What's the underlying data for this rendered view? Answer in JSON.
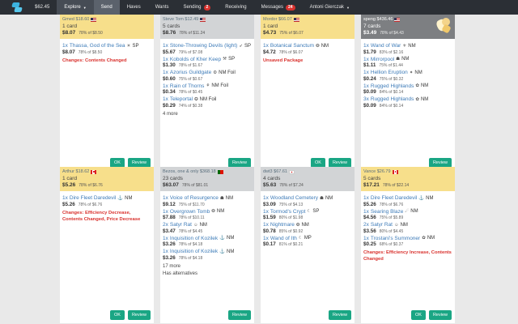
{
  "nav": {
    "balance": "$62.45",
    "explore": "Explore",
    "send": "Send",
    "haves": "Haves",
    "wants": "Wants",
    "sending": "Sending",
    "sending_count": "2",
    "receiving": "Receiving",
    "messages": "Messages",
    "messages_count": "24",
    "user": "Antoni Gierczak"
  },
  "buttons": {
    "ok": "OK",
    "review": "Review"
  },
  "cards": [
    {
      "name": "Gmed $18.60",
      "flag": "us",
      "count": "1 card",
      "total": "$8.07",
      "total_pct": "78% of $8.50",
      "items": [
        {
          "qty": "1x",
          "name": "Thassa, God of the Sea",
          "icon": "☀",
          "cond": "SP",
          "price": "$8.07",
          "pct": "78% of $8.50"
        }
      ],
      "warn": "Changes: Contents Changed",
      "ok": true
    },
    {
      "name": "Steve Tom $12.49",
      "flag": "us",
      "count": "5 cards",
      "total": "$8.76",
      "total_pct": "78% of $11.24",
      "items": [
        {
          "qty": "1x",
          "name": "Stone-Throwing Devils (light)",
          "icon": "➶",
          "cond": "SP",
          "price": "$5.67",
          "pct": "79% of $7.08"
        },
        {
          "qty": "1x",
          "name": "Kobolds of Kher Keep",
          "icon": "⚒",
          "cond": "SP",
          "price": "$1.30",
          "pct": "78% of $1.67"
        },
        {
          "qty": "1x",
          "name": "Azorius Guildgate",
          "icon": "⚙",
          "cond": "NM Foil",
          "price": "$0.60",
          "pct": "75% of $0.67"
        },
        {
          "qty": "1x",
          "name": "Rain of Thorns",
          "icon": "⚘",
          "cond": "NM Foil",
          "price": "$0.34",
          "pct": "78% of $0.45"
        },
        {
          "qty": "1x",
          "name": "Teleportal",
          "icon": "✪",
          "cond": "NM Foil",
          "price": "$0.29",
          "pct": "74% of $0.38"
        }
      ],
      "more": "4 more",
      "warn": "",
      "ok": false
    },
    {
      "name": "Mordor $66.07",
      "flag": "us",
      "count": "1 card",
      "total": "$4.73",
      "total_pct": "75% of $6.07",
      "items": [
        {
          "qty": "1x",
          "name": "Botanical Sanctum",
          "icon": "❂",
          "cond": "NM",
          "price": "$4.72",
          "pct": "78% of $6.07"
        }
      ],
      "warn": "Unsaved Package",
      "ok": true
    },
    {
      "name": "speng $436.46",
      "flag": "us",
      "count": "7 cards",
      "total": "$3.49",
      "total_pct": "78% of $4.43",
      "dark": true,
      "items": [
        {
          "qty": "1x",
          "name": "Wand of War",
          "icon": "⚜",
          "cond": "NM",
          "price": "$1.79",
          "pct": "83% of $2.16"
        },
        {
          "qty": "1x",
          "name": "Mirrorpool",
          "icon": "☗",
          "cond": "NM",
          "price": "$1.11",
          "pct": "75% of $1.44"
        },
        {
          "qty": "1x",
          "name": "Hellion Eruption",
          "icon": "✦",
          "cond": "NM",
          "price": "$0.24",
          "pct": "75% of $0.32"
        },
        {
          "qty": "1x",
          "name": "Rugged Highlands",
          "icon": "✿",
          "cond": "NM",
          "price": "$0.09",
          "pct": "84% of $0.14"
        },
        {
          "qty": "3x",
          "name": "Rugged Highlands",
          "icon": "✿",
          "cond": "NM",
          "price": "$0.09",
          "pct": "84% of $0.14"
        }
      ],
      "warn": "",
      "ok": false
    },
    {
      "name": "Arthur $18.62",
      "flag": "ca",
      "count": "1 card",
      "total": "$5.26",
      "total_pct": "78% of $6.76",
      "items": [
        {
          "qty": "1x",
          "name": "Dire Fleet Daredevil",
          "icon": "⚓",
          "cond": "NM",
          "price": "$5.26",
          "pct": "78% of $6.76"
        }
      ],
      "warn": "Changes: Efficiency Decrease, Contents Changed, Price Decrease",
      "ok": true
    },
    {
      "name": "Bezos, one & only $368.18",
      "flag": "pt",
      "count": "23 cards",
      "total": "$63.07",
      "total_pct": "78% of $81.01",
      "items": [
        {
          "qty": "1x",
          "name": "Voice of Resurgence",
          "icon": "☗",
          "cond": "NM",
          "price": "$9.12",
          "pct": "75% of $11.70"
        },
        {
          "qty": "1x",
          "name": "Overgrown Tomb",
          "icon": "❂",
          "cond": "NM",
          "price": "$7.88",
          "pct": "78% of $10.11"
        },
        {
          "qty": "2x",
          "name": "Satyr Rat",
          "icon": "☺",
          "cond": "NM",
          "price": "$3.47",
          "pct": "78% of $4.45"
        },
        {
          "qty": "1x",
          "name": "Inquisition of Kozilek",
          "icon": "⚓",
          "cond": "NM",
          "price": "$3.26",
          "pct": "78% of $4.18"
        },
        {
          "qty": "1x",
          "name": "Inquisition of Kozilek",
          "icon": "⚓",
          "cond": "NM",
          "price": "$3.26",
          "pct": "78% of $4.18"
        }
      ],
      "more": "17 more",
      "extra": "Has alternatives",
      "warn": "",
      "ok": false
    },
    {
      "name": "dwt3 $67.61",
      "flag": "jp",
      "count": "4 cards",
      "total": "$5.63",
      "total_pct": "78% of $7.24",
      "items": [
        {
          "qty": "1x",
          "name": "Woodland Cemetery",
          "icon": "☗",
          "cond": "NM",
          "price": "$3.09",
          "pct": "75% of $4.13"
        },
        {
          "qty": "1x",
          "name": "Tormod's Crypt",
          "icon": "☾",
          "cond": "SP",
          "price": "$1.59",
          "pct": "80% of $1.98"
        },
        {
          "qty": "1x",
          "name": "Nightmare",
          "icon": "❂",
          "cond": "NM",
          "price": "$0.78",
          "pct": "85% of $0.92"
        },
        {
          "qty": "1x",
          "name": "Wand of Ith",
          "icon": "☾",
          "cond": "MP",
          "price": "$0.17",
          "pct": "81% of $0.21"
        }
      ],
      "warn": "",
      "ok": false
    },
    {
      "name": "Vance $26.79",
      "flag": "ca",
      "count": "5 cards",
      "total": "$17.21",
      "total_pct": "78% of $22.14",
      "items": [
        {
          "qty": "1x",
          "name": "Dire Fleet Daredevil",
          "icon": "⚓",
          "cond": "NM",
          "price": "$5.26",
          "pct": "78% of $6.76"
        },
        {
          "qty": "1x",
          "name": "Searing Blaze",
          "icon": "☄",
          "cond": "NM",
          "price": "$4.56",
          "pct": "75% of $5.89"
        },
        {
          "qty": "2x",
          "name": "Satyr Rat",
          "icon": "☺",
          "cond": "NM",
          "price": "$3.56",
          "pct": "80% of $4.45"
        },
        {
          "qty": "1x",
          "name": "Trostani's Summoner",
          "icon": "✿",
          "cond": "NM",
          "price": "$0.25",
          "pct": "68% of $0.37"
        }
      ],
      "warn": "Changes: Efficiency Increase, Contents Changed",
      "ok": true
    }
  ]
}
